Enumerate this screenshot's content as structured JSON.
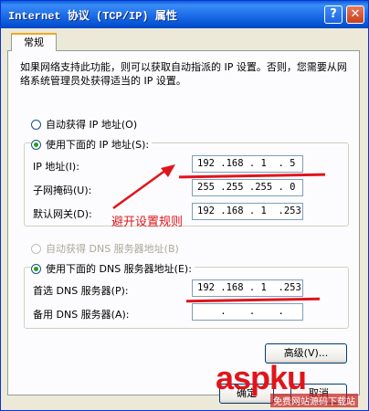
{
  "window": {
    "title": "Internet 协议 (TCP/IP) 属性",
    "help_button": "?",
    "close_button": "✕"
  },
  "tabs": [
    {
      "label": "常规",
      "active": true
    }
  ],
  "intro_text": "如果网络支持此功能，则可以获取自动指派的 IP 设置。否则，您需要从网络系统管理员处获得适当的 IP 设置。",
  "ip": {
    "auto_label": "自动获得 IP 地址(O)",
    "manual_label": "使用下面的 IP 地址(S):",
    "selected": "manual",
    "fields": [
      {
        "label": "IP 地址(I):",
        "value": "192 .168 . 1  . 5"
      },
      {
        "label": "子网掩码(U):",
        "value": "255 .255 .255 . 0"
      },
      {
        "label": "默认网关(D):",
        "value": "192 .168 . 1  .253"
      }
    ]
  },
  "dns": {
    "auto_label": "自动获得 DNS 服务器地址(B)",
    "manual_label": "使用下面的 DNS 服务器地址(E):",
    "selected": "manual",
    "fields": [
      {
        "label": "首选 DNS 服务器(P):",
        "value": "192 .168 . 1  .253"
      },
      {
        "label": "备用 DNS 服务器(A):",
        "value": "    .    .    ."
      }
    ]
  },
  "buttons": {
    "advanced": "高级(V)...",
    "ok": "确定",
    "cancel": "取消"
  },
  "annotation": "避开设置规则",
  "watermark": {
    "text": "aspku",
    "sub": "免费网站源码下载站"
  },
  "colors": {
    "titlebar": "#1f6fe9",
    "annotation": "#e0151b",
    "checked_radio": "#21a121"
  }
}
